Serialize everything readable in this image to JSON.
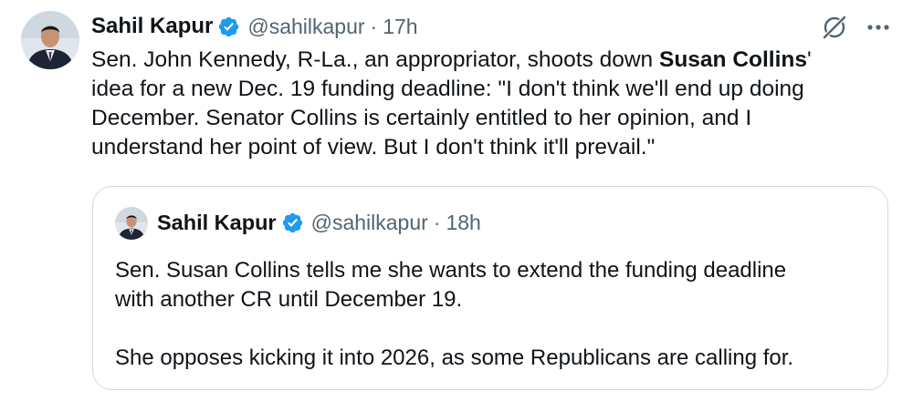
{
  "tweet": {
    "author_name": "Sahil Kapur",
    "handle": "@sahilkapur",
    "separator": "·",
    "time": "17h",
    "text_lines": [
      {
        "before": "Sen. John Kennedy, R-La., an appropriator, shoots down ",
        "bold": "Susan Collins",
        "after": "'"
      },
      "idea for a new Dec. 19 funding deadline: \"I don't think we'll end up doing",
      "December. Senator Collins is certainly entitled to her opinion, and I",
      "understand her point of view. But I don't think it'll prevail.\""
    ],
    "icons": {
      "verified": "verified-badge-icon",
      "grok": "grok-icon",
      "more": "more-options-icon"
    }
  },
  "quoted_tweet": {
    "author_name": "Sahil Kapur",
    "handle": "@sahilkapur",
    "separator": "·",
    "time": "18h",
    "paragraphs": [
      [
        "Sen. Susan Collins tells me she wants to extend the funding deadline",
        "with another CR until December 19."
      ],
      [
        "She opposes kicking it into 2026, as some Republicans are calling for."
      ]
    ]
  },
  "colors": {
    "text": "#0f1419",
    "secondary": "#536471",
    "verified": "#1d9bf0",
    "border": "#cfd9de"
  }
}
